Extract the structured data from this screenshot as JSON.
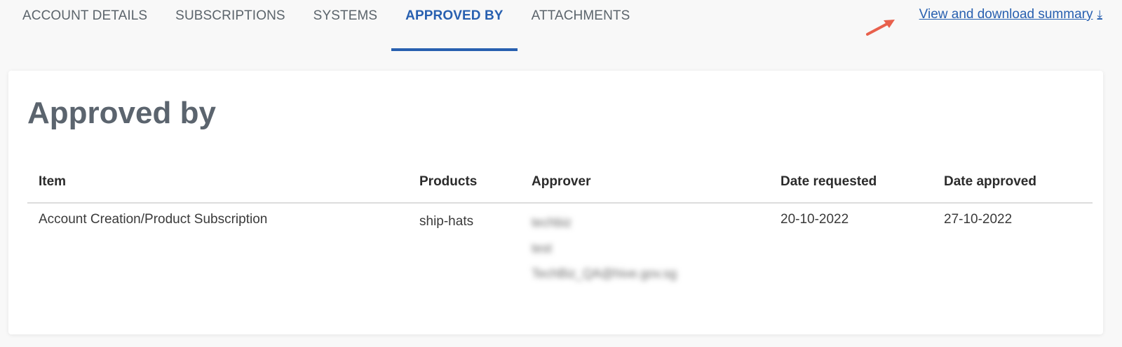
{
  "tabs": [
    {
      "label": "ACCOUNT DETAILS",
      "active": false
    },
    {
      "label": "SUBSCRIPTIONS",
      "active": false
    },
    {
      "label": "SYSTEMS",
      "active": false
    },
    {
      "label": "APPROVED BY",
      "active": true
    },
    {
      "label": "ATTACHMENTS",
      "active": false
    }
  ],
  "download": {
    "label": "View and download summary",
    "icon": "download-icon",
    "icon_glyph": "⤓"
  },
  "annotation": {
    "color": "#e8604c",
    "icon": "annotation-arrow"
  },
  "colors": {
    "accent": "#2860b0",
    "title": "#5b646e",
    "background": "#f8f8f8",
    "card": "#ffffff"
  },
  "page": {
    "title": "Approved by"
  },
  "table": {
    "headers": {
      "item": "Item",
      "products": "Products",
      "approver": "Approver",
      "date_requested": "Date requested",
      "date_approved": "Date approved"
    },
    "rows": [
      {
        "item": "Account Creation/Product Subscription",
        "products": "ship-hats",
        "approver_lines": [
          "techbiz",
          "test",
          "TechBiz_QA@hive.gov.sg"
        ],
        "approver_blurred": true,
        "date_requested": "20-10-2022",
        "date_approved": "27-10-2022"
      }
    ]
  }
}
